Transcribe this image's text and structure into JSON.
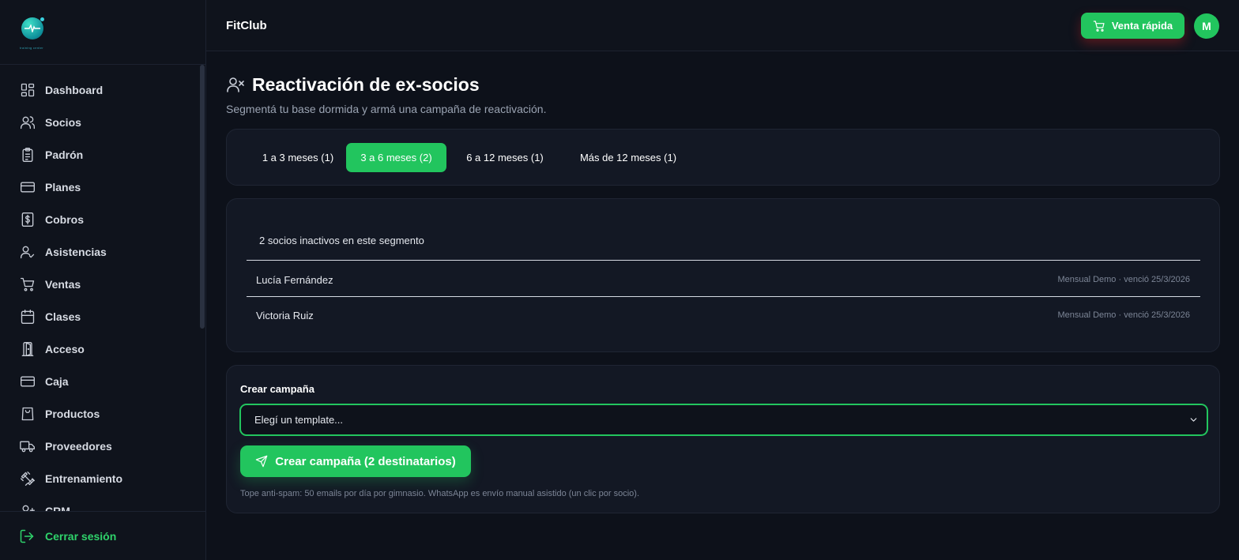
{
  "app": {
    "brand": "FitClub",
    "logo_tagline": "training center"
  },
  "colors": {
    "accent": "#22c55e",
    "background": "#0d111a",
    "card": "#131824",
    "sidebar": "#0f131c"
  },
  "sidebar": {
    "items": [
      {
        "label": "Dashboard",
        "icon": "dashboard-icon"
      },
      {
        "label": "Socios",
        "icon": "users-icon"
      },
      {
        "label": "Padrón",
        "icon": "clipboard-icon"
      },
      {
        "label": "Planes",
        "icon": "credit-card-icon"
      },
      {
        "label": "Cobros",
        "icon": "dollar-icon"
      },
      {
        "label": "Asistencias",
        "icon": "user-check-icon"
      },
      {
        "label": "Ventas",
        "icon": "cart-icon"
      },
      {
        "label": "Clases",
        "icon": "calendar-icon"
      },
      {
        "label": "Acceso",
        "icon": "door-icon"
      },
      {
        "label": "Caja",
        "icon": "cash-register-icon"
      },
      {
        "label": "Productos",
        "icon": "shopping-bag-icon"
      },
      {
        "label": "Proveedores",
        "icon": "truck-icon"
      },
      {
        "label": "Entrenamiento",
        "icon": "dumbbell-icon"
      },
      {
        "label": "CRM",
        "icon": "user-plus-icon"
      }
    ],
    "logout_label": "Cerrar sesión"
  },
  "header": {
    "quick_sale_label": "Venta rápida",
    "avatar_initial": "M"
  },
  "page": {
    "title": "Reactivación de ex-socios",
    "subtitle": "Segmentá tu base dormida y armá una campaña de reactivación."
  },
  "tabs": [
    {
      "label": "1 a 3 meses (1)",
      "active": false
    },
    {
      "label": "3 a 6 meses (2)",
      "active": true
    },
    {
      "label": "6 a 12 meses (1)",
      "active": false
    },
    {
      "label": "Más de 12 meses (1)",
      "active": false
    }
  ],
  "segment": {
    "count_text": "2 socios inactivos en este segmento",
    "members": [
      {
        "name": "Lucía Fernández",
        "meta": "Mensual Demo · venció 25/3/2026"
      },
      {
        "name": "Victoria Ruiz",
        "meta": "Mensual Demo · venció 25/3/2026"
      }
    ]
  },
  "campaign": {
    "label": "Crear campaña",
    "select_value": "Elegí un template...",
    "button_label": "Crear campaña (2 destinatarios)",
    "footnote": "Tope anti-spam: 50 emails por día por gimnasio. WhatsApp es envío manual asistido (un clic por socio)."
  }
}
